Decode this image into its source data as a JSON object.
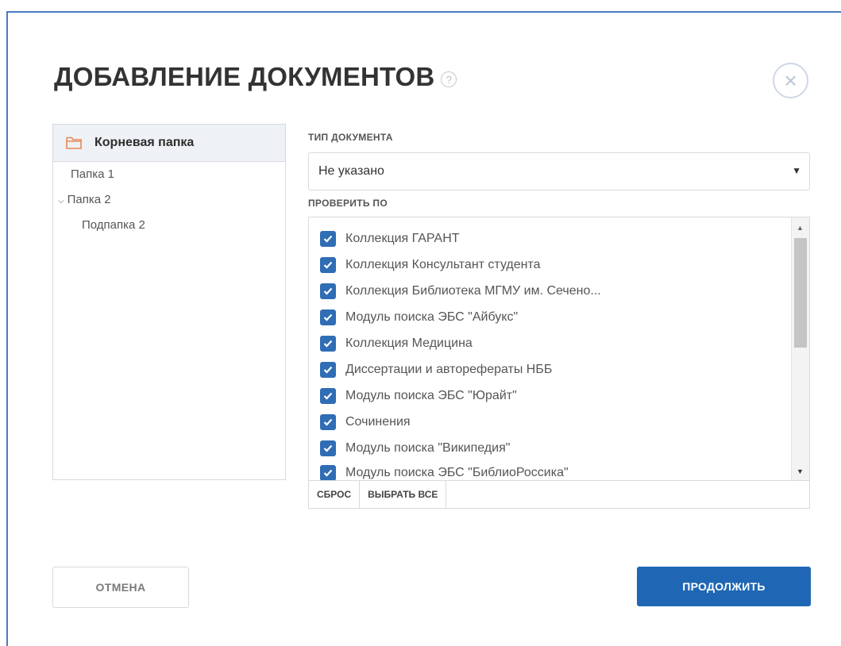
{
  "dialog": {
    "title": "ДОБАВЛЕНИЕ ДОКУМЕНТОВ",
    "help_icon": "?",
    "close_icon": "×"
  },
  "folders": {
    "root": "Корневая папка",
    "items": [
      "Папка 1",
      "Папка 2",
      "Подпапка 2"
    ],
    "expanded_chevron": "⌄"
  },
  "doc_type": {
    "label": "ТИП ДОКУМЕНТА",
    "value": "Не указано",
    "arrow": "▼"
  },
  "check_by": {
    "label": "ПРОВЕРИТЬ ПО",
    "items": [
      {
        "label": "Коллекция ГАРАНТ",
        "checked": true
      },
      {
        "label": "Коллекция Консультант студента",
        "checked": true
      },
      {
        "label": "Коллекция Библиотека МГМУ им. Сечено...",
        "checked": true
      },
      {
        "label": "Модуль поиска ЭБС \"Айбукс\"",
        "checked": true
      },
      {
        "label": "Коллекция Медицина",
        "checked": true
      },
      {
        "label": "Диссертации и авторефераты НББ",
        "checked": true
      },
      {
        "label": "Модуль поиска ЭБС \"Юрайт\"",
        "checked": true
      },
      {
        "label": "Сочинения",
        "checked": true
      },
      {
        "label": "Модуль поиска \"Википедия\"",
        "checked": true
      },
      {
        "label": "Модуль поиска ЭБС \"БиблиоРоссика\"",
        "checked": true
      }
    ],
    "reset_label": "СБРОС",
    "select_all_label": "ВЫБРАТЬ ВСЕ"
  },
  "actions": {
    "cancel_label": "ОТМЕНА",
    "continue_label": "ПРОДОЛЖИТЬ"
  },
  "colors": {
    "accent": "#1f67b4",
    "checkbox": "#2f6db5",
    "folder_icon": "#e8875a"
  }
}
